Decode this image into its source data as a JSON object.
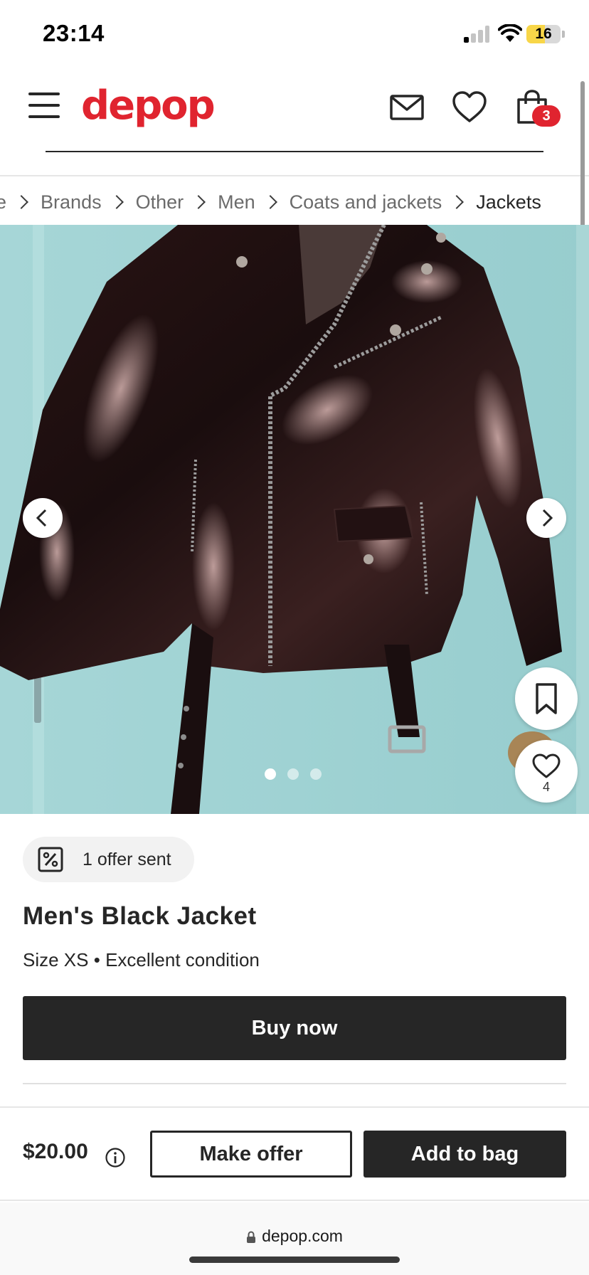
{
  "status_bar": {
    "time": "23:14",
    "battery": "16",
    "battery_level": 0.16,
    "signal_bars": 1
  },
  "header": {
    "logo": "depop",
    "menu_icon": "hamburger-menu-icon",
    "icons": [
      "mail-icon",
      "heart-icon",
      "shopping-bag-icon"
    ],
    "bag_count": "3",
    "brand_color": "#e0242f"
  },
  "breadcrumb": [
    {
      "label": "e"
    },
    {
      "label": "Brands"
    },
    {
      "label": "Other"
    },
    {
      "label": "Men"
    },
    {
      "label": "Coats and jackets"
    },
    {
      "label": "Jackets"
    }
  ],
  "product": {
    "image_alt": "Black patent leather biker jacket with belt hanging on a light blue door",
    "image_count": 3,
    "active_image": 1,
    "likes": "4",
    "offer_chip": "1 offer sent",
    "title": "Men's Black Jacket",
    "size": "Size XS",
    "condition": "Excellent condition",
    "buy_now": "Buy now"
  },
  "footer": {
    "price": "$20.00",
    "make_offer": "Make offer",
    "add_to_bag": "Add to bag"
  },
  "browser": {
    "url": "depop.com"
  },
  "colors": {
    "accent": "#e0242f",
    "primary_button": "#262626",
    "image_background": "#9fd2d3"
  }
}
